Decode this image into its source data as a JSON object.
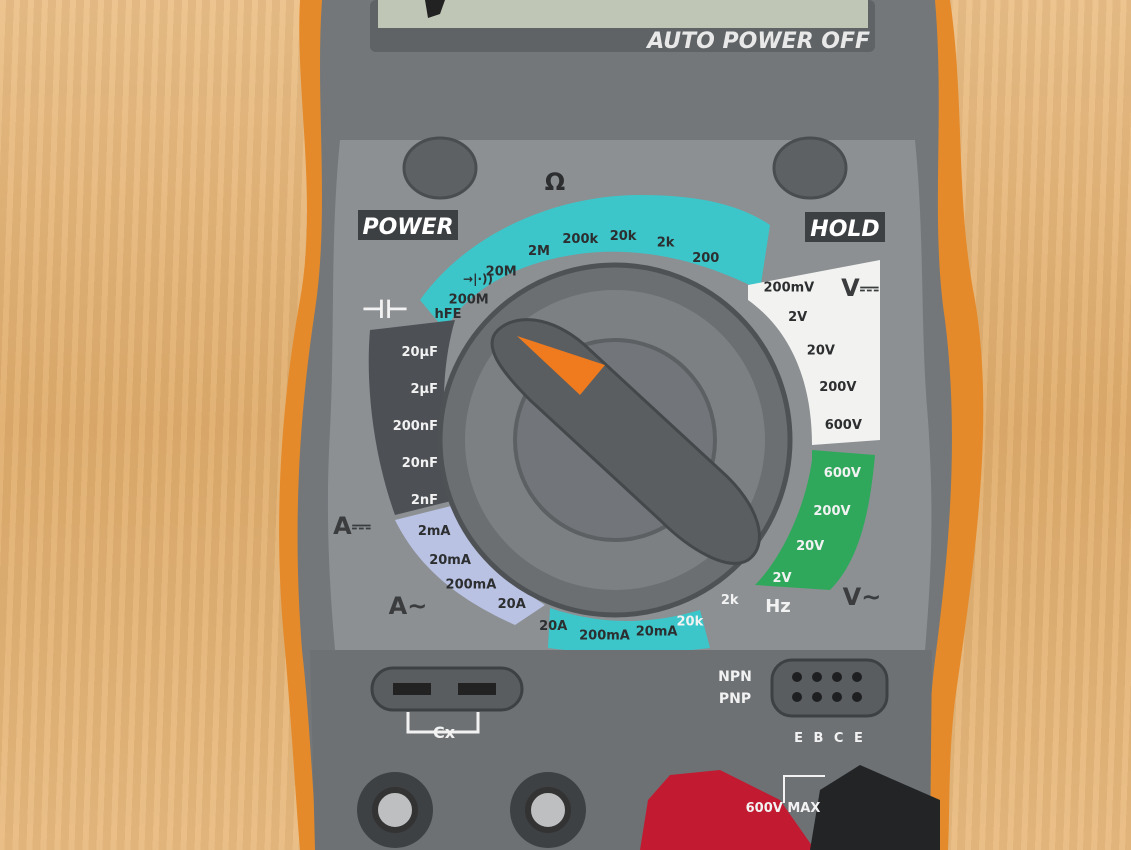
{
  "display": {
    "banner": "AUTO POWER OFF"
  },
  "buttons": {
    "power": "POWER",
    "hold": "HOLD"
  },
  "symbols": {
    "ohm": "Ω",
    "capacitance": "⊣⊢",
    "dc_amps": "A⎓",
    "ac_amps": "A~",
    "dc_volts": "V⎓",
    "ac_volts": "V~",
    "hz": "Hz"
  },
  "dial": {
    "ohm_ranges": [
      "200M",
      "20M",
      "2M",
      "200k",
      "20k",
      "2k",
      "200"
    ],
    "diode": "→|·))",
    "hfe": "hFE",
    "cap_ranges": [
      "20μF",
      "2μF",
      "200nF",
      "20nF",
      "2nF"
    ],
    "dcv_ranges": [
      "200mV",
      "2V",
      "20V",
      "200V",
      "600V"
    ],
    "acv_ranges": [
      "600V",
      "200V",
      "20V",
      "2V"
    ],
    "hz_ranges": [
      "2k",
      "20k"
    ],
    "dca_ranges": [
      "2mA",
      "20mA",
      "200mA",
      "20A"
    ],
    "aca_ranges": [
      "20A",
      "200mA",
      "20mA"
    ]
  },
  "sockets": {
    "cx": "Cx",
    "npn": "NPN",
    "pnp": "PNP",
    "ebce": "E B C E",
    "max": "600V MAX"
  },
  "colors": {
    "body": "#7b7e80",
    "orange_case": "#e58a2a",
    "cyan": "#3cc6c9",
    "white": "#f2f2f0",
    "green": "#2fa85c",
    "lavender": "#b9c2e3",
    "dark": "#4d5055",
    "knob_pointer": "#f07a1e"
  }
}
